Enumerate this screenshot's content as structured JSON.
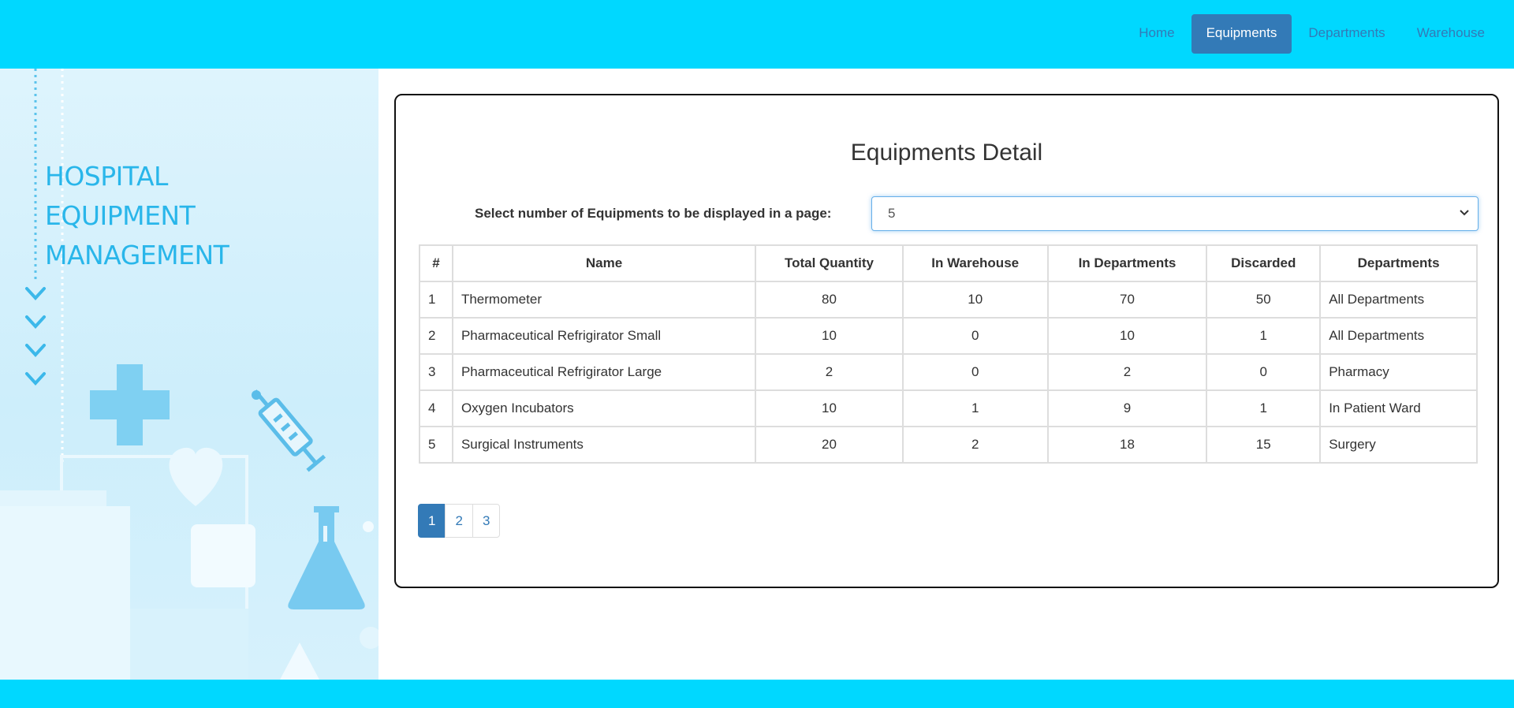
{
  "nav": {
    "items": [
      {
        "label": "Home"
      },
      {
        "label": "Equipments"
      },
      {
        "label": "Departments"
      },
      {
        "label": "Warehouse"
      }
    ],
    "active": "Equipments"
  },
  "sidebar": {
    "brand_line1": "HOSPITAL",
    "brand_line2": "EQUIPMENT",
    "brand_line3": "MANAGEMENT"
  },
  "main": {
    "title": "Equipments Detail",
    "page_size_label": "Select number of Equipments to be displayed in a page:",
    "page_size_value": "5",
    "table": {
      "headers": [
        "#",
        "Name",
        "Total Quantity",
        "In Warehouse",
        "In Departments",
        "Discarded",
        "Departments"
      ],
      "rows": [
        [
          "1",
          "Thermometer",
          "80",
          "10",
          "70",
          "50",
          "All Departments"
        ],
        [
          "2",
          "Pharmaceutical Refrigirator Small",
          "10",
          "0",
          "10",
          "1",
          "All Departments"
        ],
        [
          "3",
          "Pharmaceutical Refrigirator Large",
          "2",
          "0",
          "2",
          "0",
          "Pharmacy"
        ],
        [
          "4",
          "Oxygen Incubators",
          "10",
          "1",
          "9",
          "1",
          "In Patient Ward"
        ],
        [
          "5",
          "Surgical Instruments",
          "20",
          "2",
          "18",
          "15",
          "Surgery"
        ]
      ]
    },
    "pagination": [
      "1",
      "2",
      "3"
    ],
    "current_page": "1"
  },
  "colors": {
    "topbar": "#00d8ff",
    "accent": "#337ab7",
    "brand_text": "#29b6ea"
  }
}
